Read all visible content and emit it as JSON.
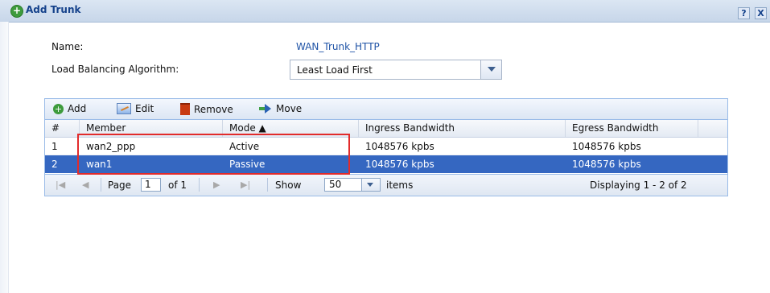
{
  "window": {
    "title": "Add Trunk",
    "help_label": "?",
    "close_label": "X"
  },
  "form": {
    "name_label": "Name:",
    "name_value": "WAN_Trunk_HTTP",
    "algorithm_label": "Load Balancing Algorithm:",
    "algorithm_value": "Least Load First"
  },
  "toolbar": {
    "add_label": "Add",
    "edit_label": "Edit",
    "remove_label": "Remove",
    "move_label": "Move"
  },
  "table": {
    "columns": [
      "#",
      "Member",
      "Mode ▲",
      "Ingress Bandwidth",
      "Egress Bandwidth"
    ],
    "rows": [
      [
        "1",
        "wan2_ppp",
        "Active",
        "1048576 kpbs",
        "1048576 kpbs"
      ],
      [
        "2",
        "wan1",
        "Passive",
        "1048576 kpbs",
        "1048576 kpbs"
      ]
    ]
  },
  "pager": {
    "page_label": "Page",
    "page_value": "1",
    "of_label": "of 1",
    "show_label": "Show",
    "show_value": "50",
    "items_label": "items",
    "display_text": "Displaying 1 - 2 of 2"
  },
  "colors": {
    "selected_row": "#3567c1",
    "highlight_box": "#e22b2b",
    "title_text": "#15428b"
  }
}
